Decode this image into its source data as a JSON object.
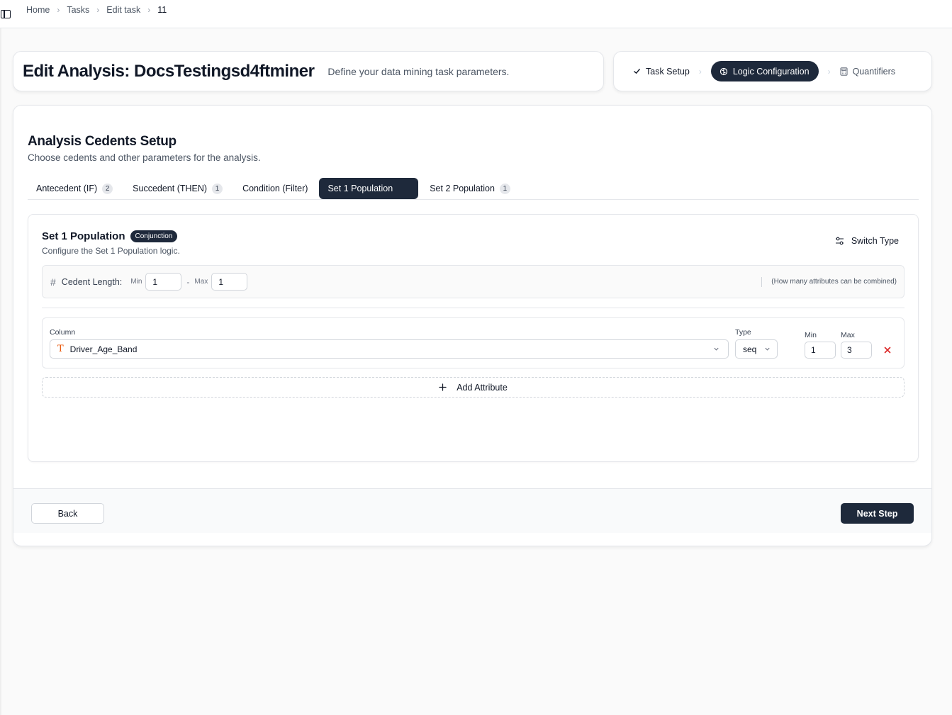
{
  "breadcrumb": {
    "items": [
      "Home",
      "Tasks",
      "Edit task",
      "11"
    ]
  },
  "header": {
    "title": "Edit Analysis: DocsTestingsd4ftminer",
    "subtitle": "Define your data mining task parameters."
  },
  "steps": [
    {
      "label": "Task Setup",
      "state": "done",
      "icon": "check-icon"
    },
    {
      "label": "Logic Configuration",
      "state": "active",
      "icon": "brain-icon"
    },
    {
      "label": "Quantifiers",
      "state": "upcoming",
      "icon": "calculator-icon"
    }
  ],
  "section": {
    "title": "Analysis Cedents Setup",
    "description": "Choose cedents and other parameters for the analysis."
  },
  "tabs": [
    {
      "label": "Antecedent (IF)",
      "count": "2"
    },
    {
      "label": "Succedent (THEN)",
      "count": "1"
    },
    {
      "label": "Condition (Filter)",
      "count": null
    },
    {
      "label": "Set 1 Population",
      "count": null,
      "active": true
    },
    {
      "label": "Set 2 Population",
      "count": "1"
    }
  ],
  "panel": {
    "title": "Set 1 Population",
    "badge": "Conjunction",
    "description": "Configure the Set 1 Population logic.",
    "switch_label": "Switch Type",
    "cedent_length": {
      "label": "Cedent Length:",
      "min_label": "Min",
      "min_value": "1",
      "dash": "-",
      "max_label": "Max",
      "max_value": "1",
      "help": "(How many attributes can be combined)"
    },
    "attribute": {
      "column_label": "Column",
      "column_value": "Driver_Age_Band",
      "column_type_icon": "T",
      "type_label": "Type",
      "type_value": "seq",
      "min_label": "Min",
      "min_value": "1",
      "max_label": "Max",
      "max_value": "3"
    },
    "add_attribute_label": "Add Attribute"
  },
  "footer": {
    "back_label": "Back",
    "next_label": "Next Step"
  },
  "colors": {
    "primary": "#1e293b",
    "accent_orange": "#ea580c",
    "danger": "#dc2626"
  }
}
